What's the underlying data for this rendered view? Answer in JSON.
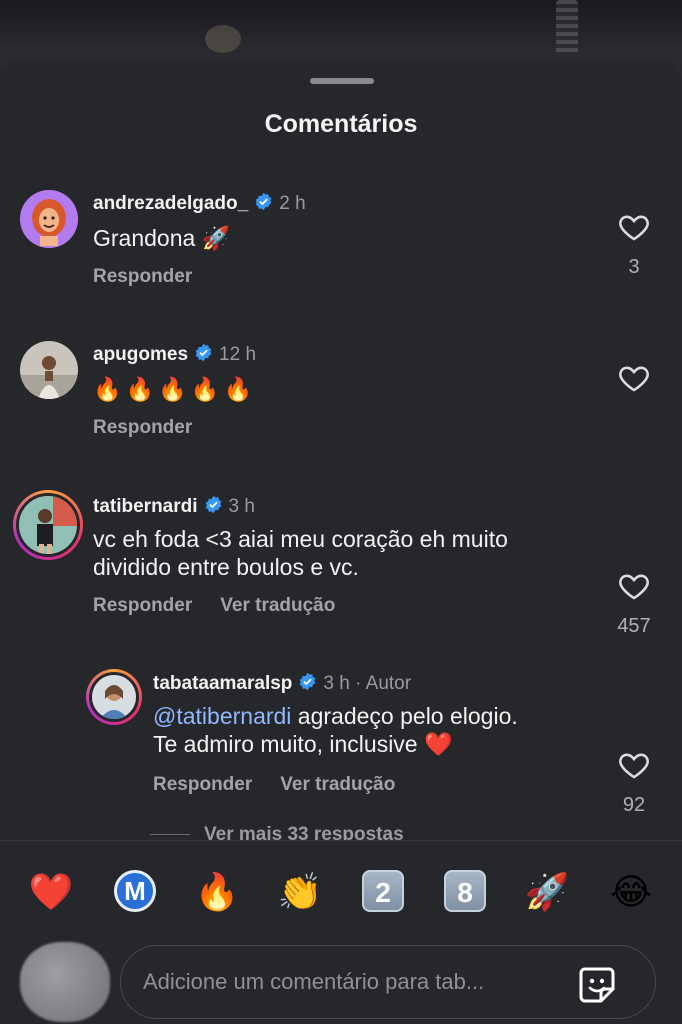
{
  "sheet": {
    "title": "Comentários"
  },
  "comments": [
    {
      "username": "andrezadelgado_",
      "time": "2 h",
      "text": "Grandona 🚀",
      "reply_label": "Responder",
      "likes": "3"
    },
    {
      "username": "apugomes",
      "time": "12 h",
      "text": "🔥🔥🔥🔥🔥",
      "reply_label": "Responder",
      "likes": ""
    },
    {
      "username": "tatibernardi",
      "time": "3 h",
      "text_line1": "vc eh foda <3 aiai meu coração eh muito",
      "text_line2": "dividido entre boulos e vc.",
      "reply_label": "Responder",
      "translate_label": "Ver tradução",
      "likes": "457"
    },
    {
      "username": "tabataamaralsp",
      "time": "3 h · Autor",
      "mention": "@tatibernardi",
      "text_line1_rest": " agradeço pelo elogio.",
      "text_line2": "Te admiro muito, inclusive ❤️",
      "reply_label": "Responder",
      "translate_label": "Ver tradução",
      "likes": "92"
    }
  ],
  "view_more": "Ver mais 33 respostas",
  "emoji_bar": [
    "❤️",
    "Ⓜ️",
    "🔥",
    "👏",
    "2️⃣",
    "8️⃣",
    "🚀",
    "😂"
  ],
  "input": {
    "placeholder": "Adicione um comentário para tab..."
  },
  "colors": {
    "background": "#26272b",
    "verified": "#3897f0",
    "mention": "#8fb8ff"
  },
  "icons": [
    "heart-icon",
    "verified-badge-icon",
    "sticker-icon"
  ]
}
